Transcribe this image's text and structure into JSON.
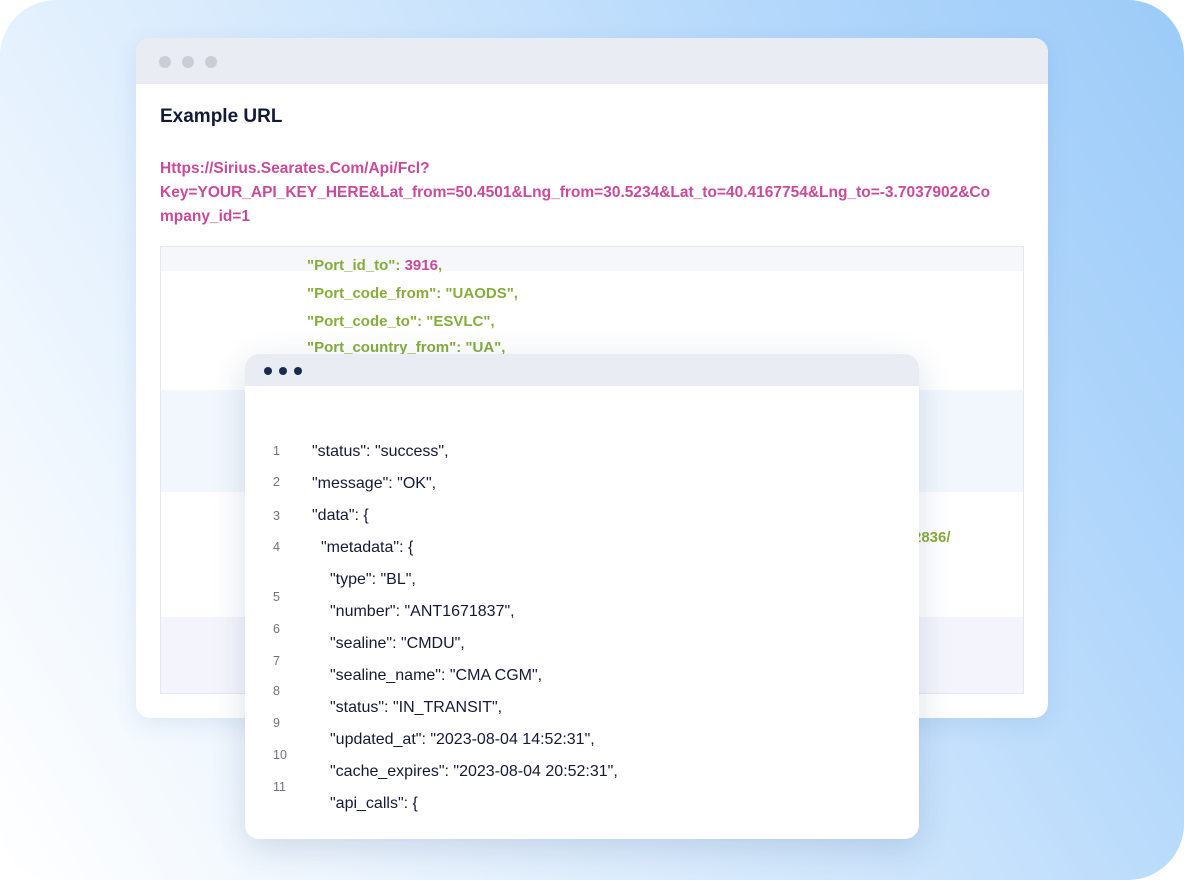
{
  "colors": {
    "url_text": "#c94a99",
    "json_key": "#85ad3a",
    "json_number": "#c94a99",
    "code_text": "#141a33"
  },
  "url_card": {
    "title": "Example URL",
    "url_lines": [
      "Https://Sirius.Searates.Com/Api/Fcl?",
      "Key=YOUR_API_KEY_HERE&Lat_from=50.4501&Lng_from=30.5234&Lat_to=40.4167754&Lng_to=-3.7037902&Co",
      "mpany_id=1"
    ],
    "code_lines": [
      {
        "key": "\"Port_id_to\": ",
        "value": "3916",
        "tail": ","
      },
      {
        "key": "\"Port_code_from\": \"UAODS\",",
        "value": "",
        "tail": ""
      },
      {
        "key": "\"Port_code_to\": \"ESVLC\",",
        "value": "",
        "tail": ""
      },
      {
        "key": "\"Port_country_from\": \"UA\",",
        "value": "",
        "tail": ""
      }
    ],
    "partial_fragment": "2836/"
  },
  "response_card": {
    "line_numbers": [
      "1",
      "2",
      "3",
      "4",
      "5",
      "6",
      "7",
      "8",
      "9",
      "10",
      "11"
    ],
    "code_lines": [
      "\"status\": \"success\",",
      "\"message\": \"OK\",",
      "\"data\": {",
      "\"metadata\": {",
      "\"type\": \"BL\",",
      "\"number\": \"ANT1671837\",",
      "\"sealine\": \"CMDU\",",
      "\"sealine_name\": \"CMA CGM\",",
      "\"status\": \"IN_TRANSIT\",",
      "\"updated_at\": \"2023-08-04 14:52:31\",",
      "\"cache_expires\": \"2023-08-04 20:52:31\",",
      "\"api_calls\": {"
    ]
  }
}
